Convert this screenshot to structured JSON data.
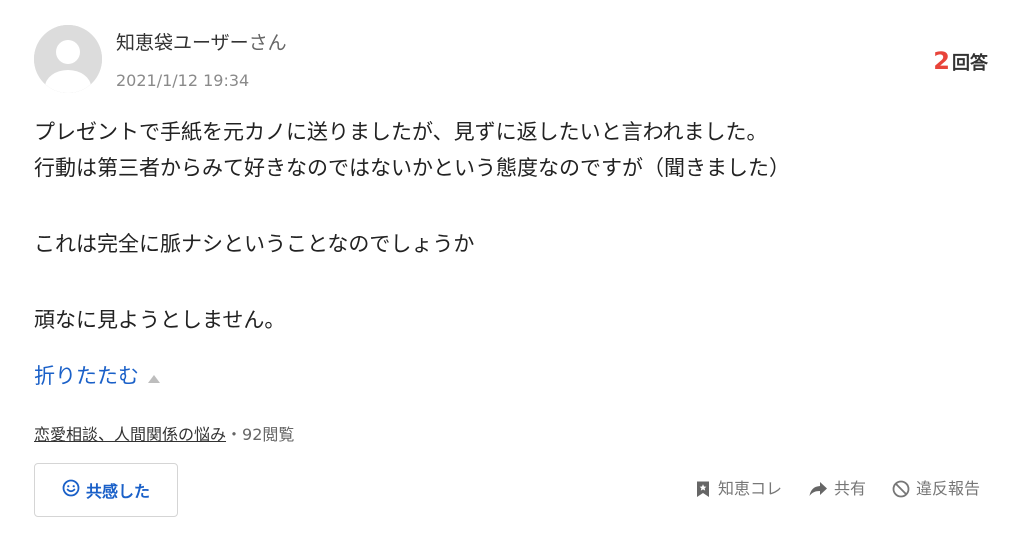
{
  "user": {
    "name": "知恵袋ユーザー",
    "honorific": "さん",
    "date": "2021/1/12 19:34"
  },
  "answers": {
    "count": "2",
    "label": "回答"
  },
  "question": {
    "lines": [
      "プレゼントで手紙を元カノに送りましたが、見ずに返したいと言われました。",
      "行動は第三者からみて好きなのではないかという態度なのですが（聞きました）",
      "これは完全に脈ナシということなのでしょうか",
      "頑なに見ようとしません。"
    ]
  },
  "collapse": {
    "label": "折りたたむ"
  },
  "meta": {
    "category": "恋愛相談、人間関係の悩み",
    "separator": "・",
    "views": "92閲覧"
  },
  "buttons": {
    "empathy": "共感した",
    "chiebukuro_kore": "知恵コレ",
    "share": "共有",
    "report": "違反報告"
  },
  "colors": {
    "accent_blue": "#1a60c8",
    "answer_red": "#e8443a",
    "avatar_bg": "#dcdcdc"
  },
  "icons": [
    "avatar-icon",
    "collapse-triangle-icon",
    "smile-icon",
    "bookmark-icon",
    "share-arrow-icon",
    "prohibit-icon"
  ]
}
